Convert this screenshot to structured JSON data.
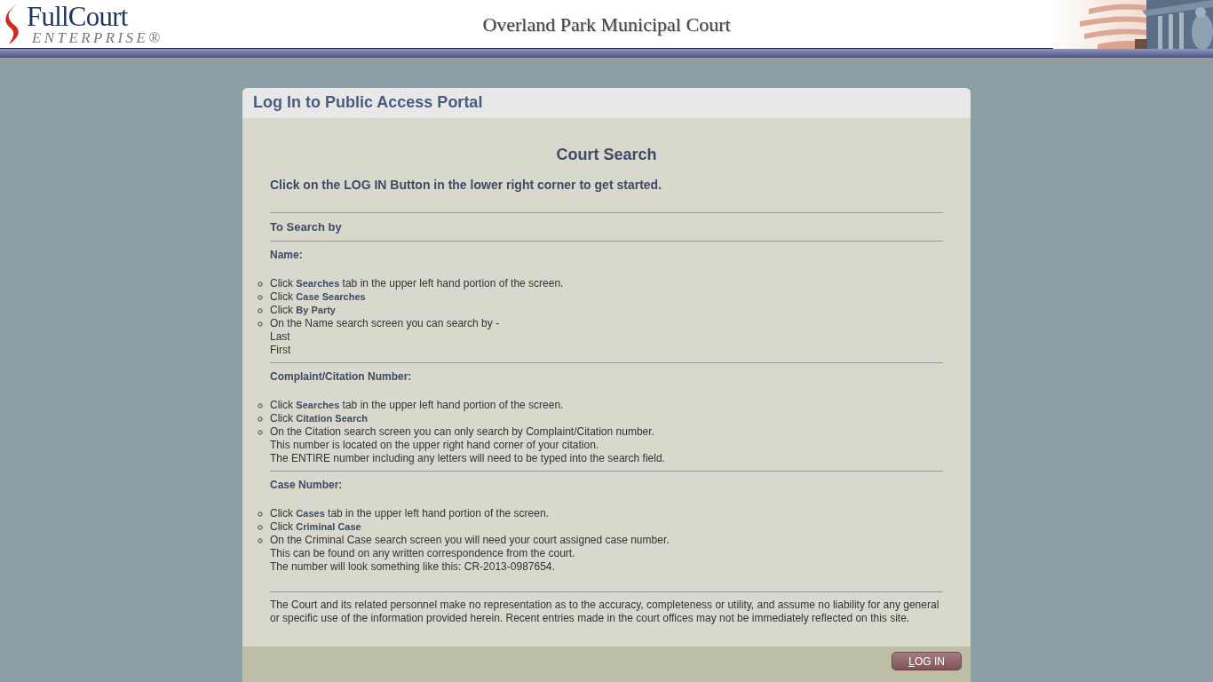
{
  "header": {
    "logo": {
      "name": "FullCourt",
      "subtitle": "ENTERPRISE®"
    },
    "title": "Overland Park Municipal Court"
  },
  "panel": {
    "title": "Log In to Public Access Portal",
    "heading": "Court Search",
    "intro": "Click on the LOG IN Button in the lower right corner to get started.",
    "section_title": "To Search by",
    "groups": [
      {
        "title": "Name:",
        "items": [
          {
            "text": "Click **Searches** tab in the upper left hand portion of the screen."
          },
          {
            "text": "Click **Case Searches**"
          },
          {
            "text": "Click **By Party**"
          },
          {
            "text": "On the Name search screen you can search by -",
            "lines": [
              "Last",
              "First"
            ]
          }
        ]
      },
      {
        "title": "Complaint/Citation Number:",
        "items": [
          {
            "text": "Click **Searches** tab in the upper left hand portion of the screen."
          },
          {
            "text": "Click **Citation Search**"
          },
          {
            "text": "On the Citation search screen you can only search by Complaint/Citation number.",
            "lines": [
              "This number is located on the upper right hand corner of your citation.",
              "The ENTIRE number including any letters will need to be typed into the search field."
            ]
          }
        ]
      },
      {
        "title": "Case Number:",
        "items": [
          {
            "text": "Click **Cases** tab in the upper left hand portion of the screen."
          },
          {
            "text": "Click **Criminal Case**"
          },
          {
            "text": "On the Criminal Case search screen you will need your court assigned case number.",
            "lines": [
              "This can be found on any written correspondence from the court.",
              "The number will look something like this: CR-2013-0987654."
            ]
          }
        ]
      }
    ],
    "disclaimer": "The Court and its related personnel make no representation as to the accuracy, completeness or utility, and assume no liability for any general or specific use of the information provided herein. Recent entries made in the court offices may not be immediately reflected on this site.",
    "login_button": "LOG IN"
  }
}
